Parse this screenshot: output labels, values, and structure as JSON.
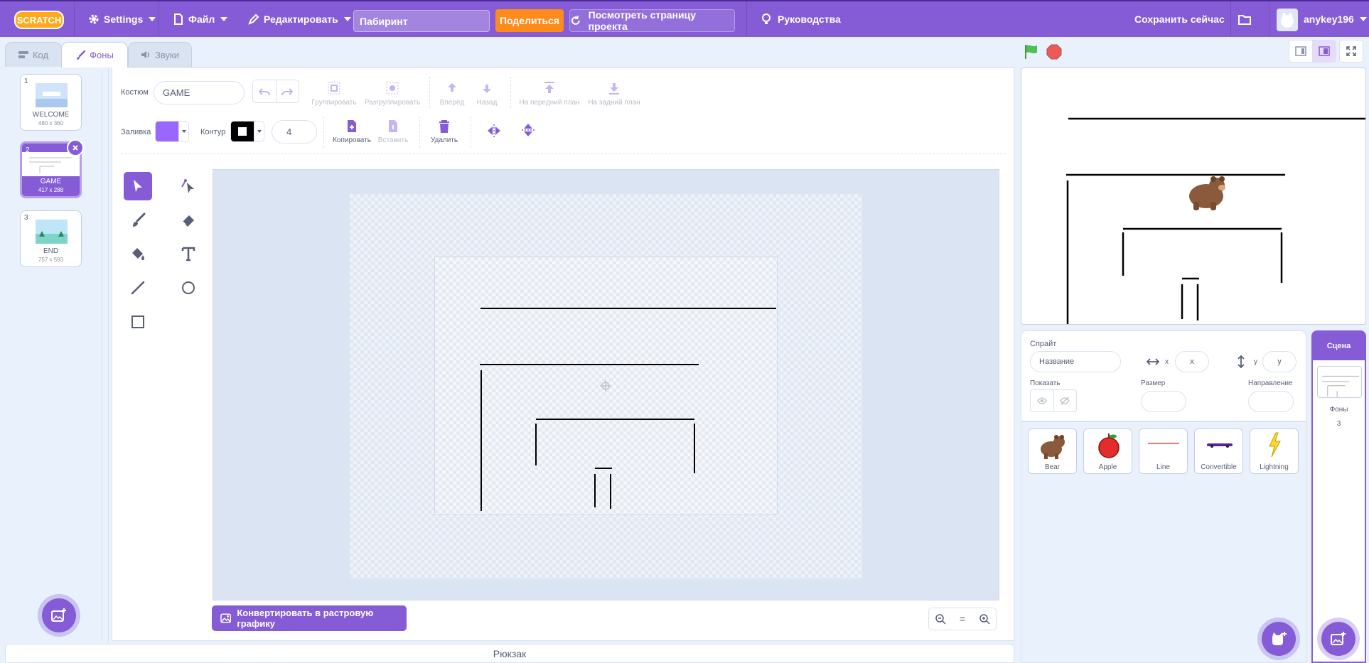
{
  "menubar": {
    "logo_text": "SCRATCH",
    "settings": "Settings",
    "file": "Файл",
    "edit": "Редактировать",
    "project_title": "Пабиринт",
    "share": "Поделиться",
    "see_project_page": "Посмотреть страницу проекта",
    "tutorials": "Руководства",
    "save_now": "Сохранить сейчас",
    "username": "anykey196"
  },
  "tabs": {
    "code": "Код",
    "backdrops": "Фоны",
    "sounds": "Звуки"
  },
  "costumes": [
    {
      "num": "1",
      "name": "WELCOME",
      "size": "480 x 360"
    },
    {
      "num": "2",
      "name": "GAME",
      "size": "417 x 288"
    },
    {
      "num": "3",
      "name": "END",
      "size": "757 x 593"
    }
  ],
  "paint": {
    "costume_label": "Костюм",
    "costume_name": "GAME",
    "group": "Группировать",
    "ungroup": "Разгруппировать",
    "forward": "Вперёд",
    "backward": "Назад",
    "front": "На передний план",
    "back": "На задний план",
    "fill_label": "Заливка",
    "outline_label": "Контур",
    "outline_width": "4",
    "copy": "Копировать",
    "paste": "Вставить",
    "delete": "Удалить",
    "fill_color": "#9966ff",
    "outline_color": "#000000",
    "convert": "Конвертировать в растровую графику",
    "zoom_reset": "="
  },
  "backpack": "Рюкзак",
  "sprite_info": {
    "sprite_label": "Спрайт",
    "name_placeholder": "Название",
    "x_label": "x",
    "x_placeholder": "x",
    "y_label": "y",
    "y_placeholder": "y",
    "show_label": "Показать",
    "size_label": "Размер",
    "direction_label": "Направление"
  },
  "sprites": [
    {
      "name": "Bear"
    },
    {
      "name": "Apple"
    },
    {
      "name": "Line"
    },
    {
      "name": "Convertible"
    },
    {
      "name": "Lightning"
    }
  ],
  "stage_selector": {
    "title": "Сцена",
    "backdrops_label": "Фоны",
    "backdrops_count": "3"
  }
}
